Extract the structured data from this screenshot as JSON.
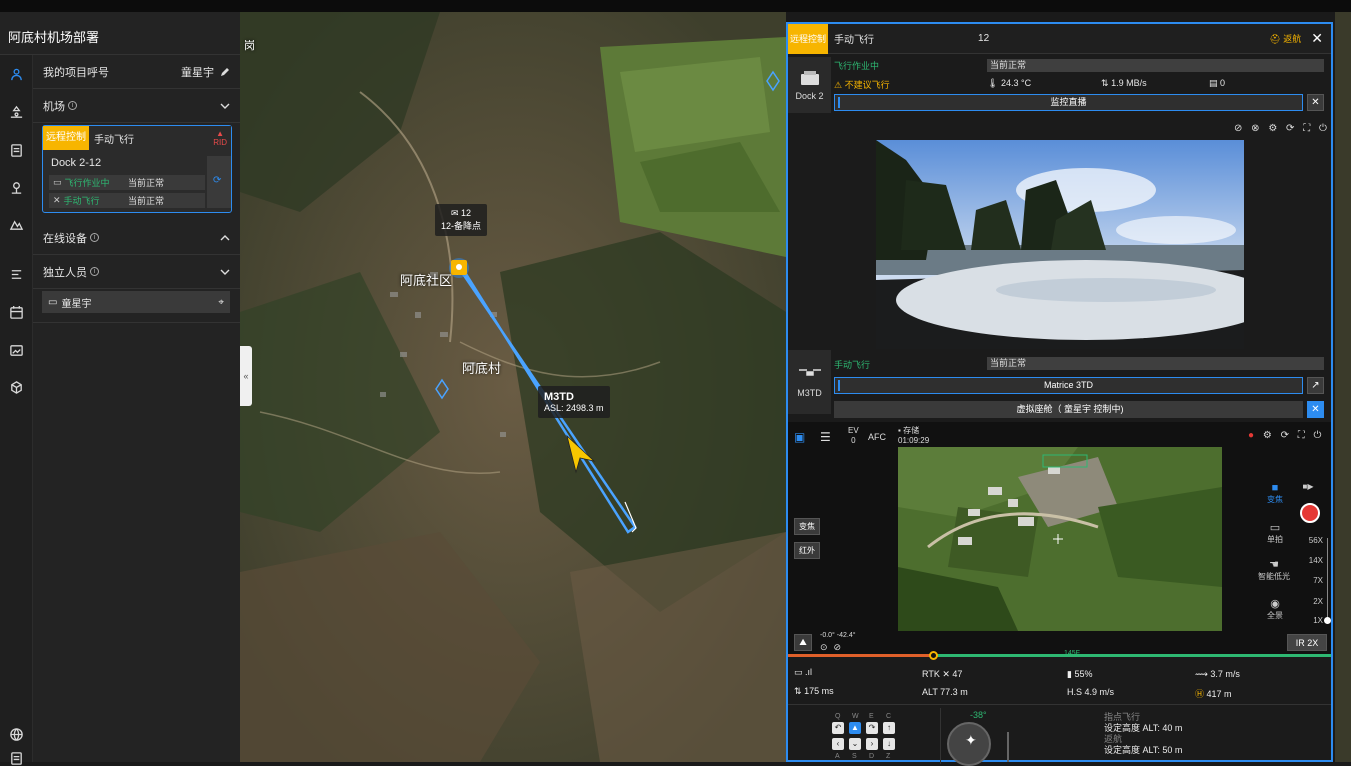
{
  "sidebar": {
    "project_title": "阿底村机场部署",
    "project_callsign_label": "我的项目呼号",
    "project_callsign_user": "童星宇",
    "airport_section": "机场",
    "dock_card": {
      "tag": "远程控制",
      "mode": "手动飞行",
      "rid": "RID",
      "name": "Dock 2-12",
      "rows": [
        {
          "label": "飞行作业中",
          "value": "当前正常"
        },
        {
          "label": "手动飞行",
          "value": "当前正常"
        }
      ]
    },
    "online_devices": "在线设备",
    "independent_personnel": "独立人员",
    "person_name": "童星宇",
    "collapse_glyph": "«"
  },
  "map": {
    "labels": [
      {
        "text": "阿底社区"
      },
      {
        "text": "阿底村"
      },
      {
        "text": "岗"
      }
    ],
    "dock_marker": {
      "count": "12",
      "name": "12-备降点"
    },
    "drone_tooltip": {
      "name": "M3TD",
      "asl": "ASL: 2498.3 m"
    }
  },
  "right_panel": {
    "header": {
      "tag": "远程控制",
      "mode": "手动飞行",
      "number": "12",
      "back": "返航",
      "close": "✕"
    },
    "dock": {
      "label": "Dock 2",
      "status": "飞行作业中",
      "status_value": "当前正常",
      "warning": "不建议飞行",
      "temperature": "24.3 °C",
      "speed": "1.9 MB/s",
      "count": "0",
      "live_button": "监控直播"
    },
    "drone": {
      "label": "M3TD",
      "status": "手动飞行",
      "status_value": "当前正常",
      "model_button": "Matrice 3TD",
      "control_button": "虚拟座舱（ 童星宇 控制中)"
    },
    "camera": {
      "ev_label": "EV",
      "ev_value": "0",
      "afc": "AFC",
      "storage_label": "存储",
      "storage_time": "01:09:29",
      "modes": [
        "变焦",
        "红外"
      ],
      "side_labels": [
        "变焦",
        "单拍",
        "智能低光",
        "全景"
      ],
      "zoom_levels": [
        "56X",
        "14X",
        "7X",
        "2X",
        "1X"
      ],
      "ir_zoom": "IR 2X",
      "gimbal": "-0.0° -42.4°",
      "timeline_marker": "145F"
    },
    "telemetry": {
      "latency": "175 ms",
      "rtk": "RTK",
      "rtk_count": "47",
      "alt": "ALT 77.3 m",
      "battery": "55%",
      "hs": "H.S 4.9 m/s",
      "wind": "3.7 m/s",
      "home": "417 m"
    },
    "controls": {
      "keys_top": [
        "Q",
        "W",
        "E",
        "C"
      ],
      "keys_bottom": [
        "A",
        "S",
        "D",
        "Z"
      ],
      "heading": "-38°",
      "flight_to_point_label": "指点飞行",
      "flight_to_point_alt": "设定高度 ALT: 40 m",
      "return_label": "返航",
      "return_alt": "设定高度 ALT: 50 m"
    }
  },
  "colors": {
    "accent": "#2d8cf0",
    "warning": "#f7b500",
    "ok": "#2eb872",
    "record": "#e53935"
  }
}
